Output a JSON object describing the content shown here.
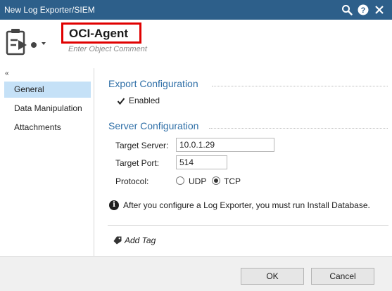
{
  "window": {
    "title": "New Log Exporter/SIEM"
  },
  "header": {
    "object_name": "OCI-Agent",
    "comment_placeholder": "Enter Object Comment"
  },
  "sidebar": {
    "collapse_glyph": "«",
    "items": [
      {
        "label": "General",
        "active": true
      },
      {
        "label": "Data Manipulation",
        "active": false
      },
      {
        "label": "Attachments",
        "active": false
      }
    ]
  },
  "export_config": {
    "title": "Export Configuration",
    "enabled_label": "Enabled",
    "enabled": true
  },
  "server_config": {
    "title": "Server Configuration",
    "target_server_label": "Target Server:",
    "target_server_value": "10.0.1.29",
    "target_port_label": "Target Port:",
    "target_port_value": "514",
    "protocol_label": "Protocol:",
    "protocol_options": [
      "UDP",
      "TCP"
    ],
    "protocol_selected": "TCP"
  },
  "info": {
    "message": "After you configure a Log Exporter, you must run Install Database."
  },
  "tags": {
    "add_label": "Add Tag"
  },
  "footer": {
    "ok_label": "OK",
    "cancel_label": "Cancel"
  },
  "colors": {
    "titlebar": "#2d5f8a",
    "accent": "#2f6fa7",
    "selection": "#c5e1f7",
    "highlight_border": "#e00000"
  }
}
